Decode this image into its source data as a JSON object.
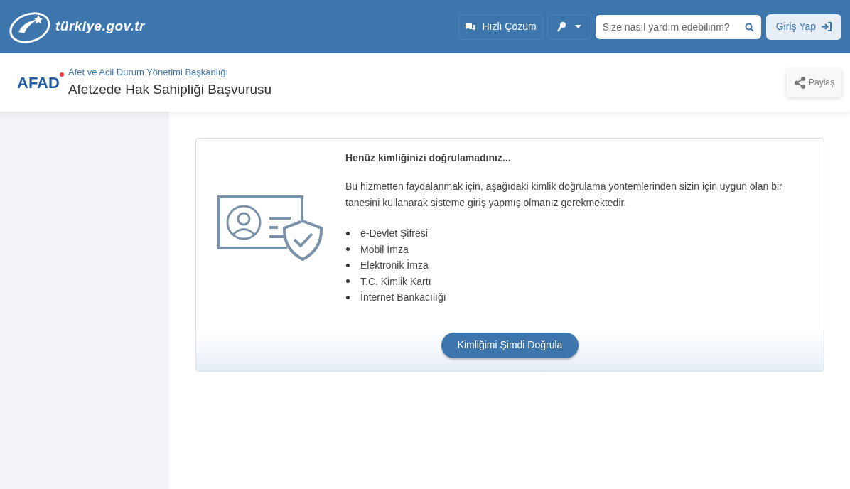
{
  "header": {
    "logo": "türkiye.gov.tr",
    "quick_solution": "Hızlı Çözüm",
    "search": {
      "placeholder": "Size nasıl yardım edebilirim?"
    },
    "login": "Giriş Yap"
  },
  "agency": {
    "logo": "AFAD",
    "name": "Afet ve Acil Durum Yönetimi Başkanlığı",
    "service": "Afetzede Hak Sahipliği Başvurusu",
    "share": "Paylaş"
  },
  "notice": {
    "title": "Henüz kimliğinizi doğrulamadınız...",
    "text": "Bu hizmetten faydalanmak için, aşağıdaki kimlik doğrulama yöntemlerinden sizin için uygun olan bir tanesini kullanarak sisteme giriş yapmış olmanız gerekmektedir.",
    "methods": [
      "e-Devlet Şifresi",
      "Mobil İmza",
      "Elektronik İmza",
      "T.C. Kimlik Kartı",
      "İnternet Bankacılığı"
    ],
    "button": "Kimliğimi Şimdi Doğrula"
  }
}
